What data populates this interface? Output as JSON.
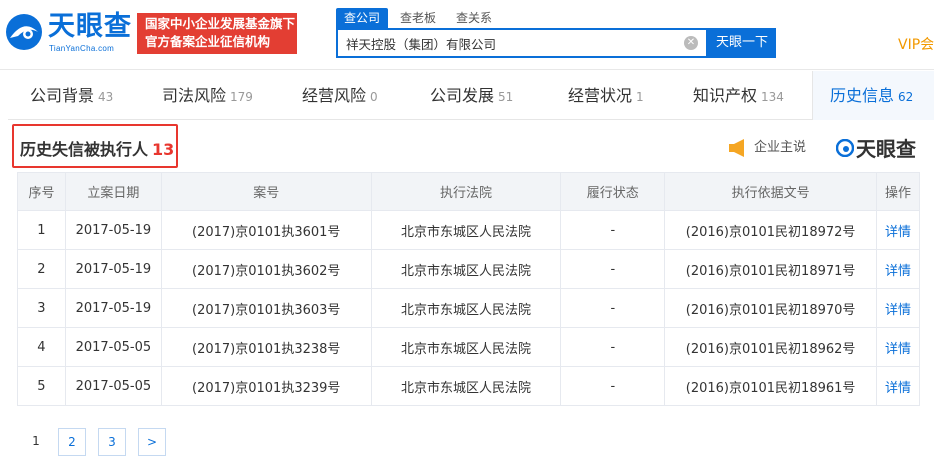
{
  "header": {
    "logo_text": "天眼查",
    "logo_sub": "TianYanCha.com",
    "banner_line1": "国家中小企业发展基金旗下",
    "banner_line2": "官方备案企业征信机构",
    "search_tabs": [
      "查公司",
      "查老板",
      "查关系"
    ],
    "search_value": "祥天控股（集团）有限公司",
    "clear_glyph": "✕",
    "search_button": "天眼一下",
    "vip": "VIP会"
  },
  "nav": {
    "items": [
      {
        "label": "公司背景",
        "count": "43"
      },
      {
        "label": "司法风险",
        "count": "179"
      },
      {
        "label": "经营风险",
        "count": "0"
      },
      {
        "label": "公司发展",
        "count": "51"
      },
      {
        "label": "经营状况",
        "count": "1"
      },
      {
        "label": "知识产权",
        "count": "134"
      },
      {
        "label": "历史信息",
        "count": "62"
      }
    ]
  },
  "section": {
    "title": "历史失信被执行人",
    "count": "13",
    "owner_say": "企业主说",
    "brand": "天眼查"
  },
  "table": {
    "headers": [
      "序号",
      "立案日期",
      "案号",
      "执行法院",
      "履行状态",
      "执行依据文号",
      "操作"
    ],
    "rows": [
      {
        "no": "1",
        "date": "2017-05-19",
        "case": "(2017)京0101执3601号",
        "court": "北京市东城区人民法院",
        "status": "-",
        "basis": "(2016)京0101民初18972号",
        "action": "详情"
      },
      {
        "no": "2",
        "date": "2017-05-19",
        "case": "(2017)京0101执3602号",
        "court": "北京市东城区人民法院",
        "status": "-",
        "basis": "(2016)京0101民初18971号",
        "action": "详情"
      },
      {
        "no": "3",
        "date": "2017-05-19",
        "case": "(2017)京0101执3603号",
        "court": "北京市东城区人民法院",
        "status": "-",
        "basis": "(2016)京0101民初18970号",
        "action": "详情"
      },
      {
        "no": "4",
        "date": "2017-05-05",
        "case": "(2017)京0101执3238号",
        "court": "北京市东城区人民法院",
        "status": "-",
        "basis": "(2016)京0101民初18962号",
        "action": "详情"
      },
      {
        "no": "5",
        "date": "2017-05-05",
        "case": "(2017)京0101执3239号",
        "court": "北京市东城区人民法院",
        "status": "-",
        "basis": "(2016)京0101民初18961号",
        "action": "详情"
      }
    ]
  },
  "pagination": {
    "pages": [
      "1",
      "2",
      "3"
    ],
    "next": ">",
    "current": "1"
  },
  "colors": {
    "brand_blue": "#0a6fd8",
    "alert_red": "#e8362e",
    "vip_orange": "#f29900"
  }
}
